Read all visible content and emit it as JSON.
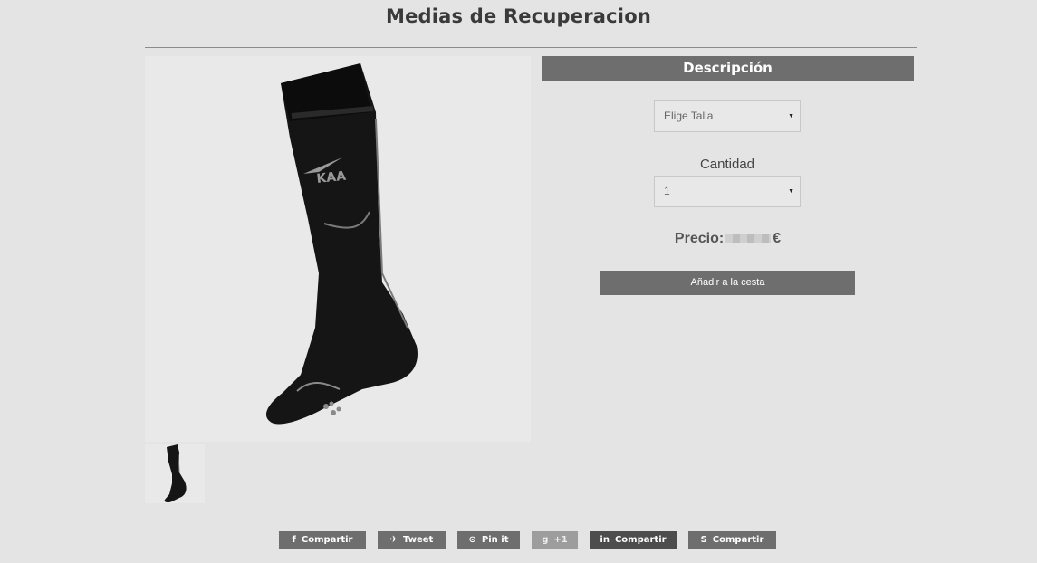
{
  "product": {
    "title": "Medias de Recuperacion"
  },
  "description": {
    "header": "Descripción"
  },
  "options": {
    "size_select_value": "Elige Talla",
    "quantity_label": "Cantidad",
    "quantity_value": "1"
  },
  "price": {
    "label": "Precio:",
    "currency": "€"
  },
  "cart": {
    "add_label": "Añadir a la cesta"
  },
  "share": [
    {
      "icon": "facebook-icon",
      "label": "Compartir"
    },
    {
      "icon": "twitter-icon",
      "label": "Tweet"
    },
    {
      "icon": "pinterest-icon",
      "label": "Pin it"
    },
    {
      "icon": "google-plus-icon",
      "label": "+1"
    },
    {
      "icon": "linkedin-icon",
      "label": "Compartir"
    },
    {
      "icon": "skype-icon",
      "label": "Compartir"
    }
  ],
  "colors": {
    "background": "#e4e4e4",
    "header_bar": "#6e6e6e",
    "share_button": "#6e6e6e"
  }
}
